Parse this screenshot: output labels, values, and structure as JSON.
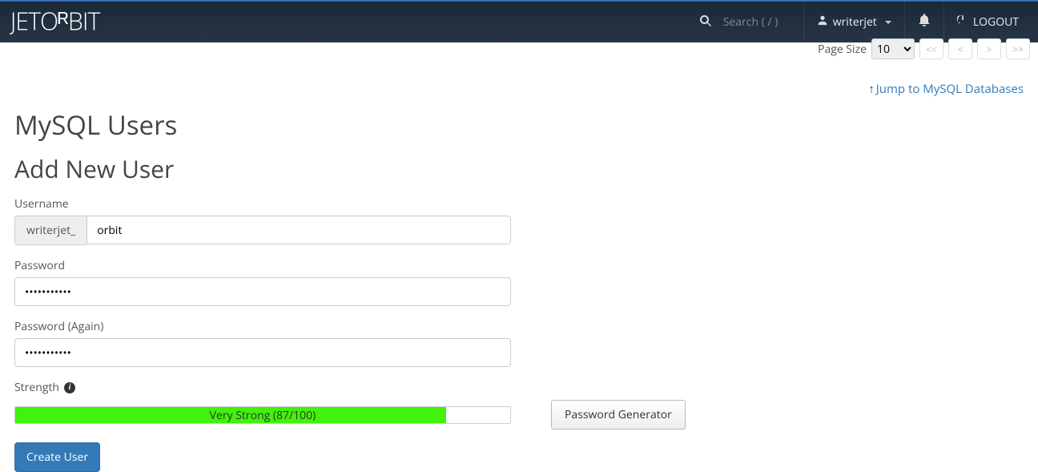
{
  "navbar": {
    "search_placeholder": "Search ( / )",
    "username": "writerjet",
    "logout_label": "LOGOUT"
  },
  "page_size": {
    "label": "Page Size",
    "value": "10"
  },
  "pager": {
    "first": "<<",
    "prev": "<",
    "next": ">",
    "last": ">>"
  },
  "jump_link": {
    "arrow": "↑",
    "text": "Jump to MySQL Databases"
  },
  "headings": {
    "page_title": "MySQL Users",
    "section_title": "Add New User"
  },
  "form": {
    "username_label": "Username",
    "username_prefix": "writerjet_",
    "username_value": "orbit",
    "password_label": "Password",
    "password_value": "•••••••••••",
    "password_again_label": "Password (Again)",
    "password_again_value": "•••••••••••",
    "strength_label": "Strength",
    "strength_text": "Very Strong (87/100)",
    "strength_percent": 87,
    "password_generator_label": "Password Generator",
    "create_user_label": "Create User"
  }
}
